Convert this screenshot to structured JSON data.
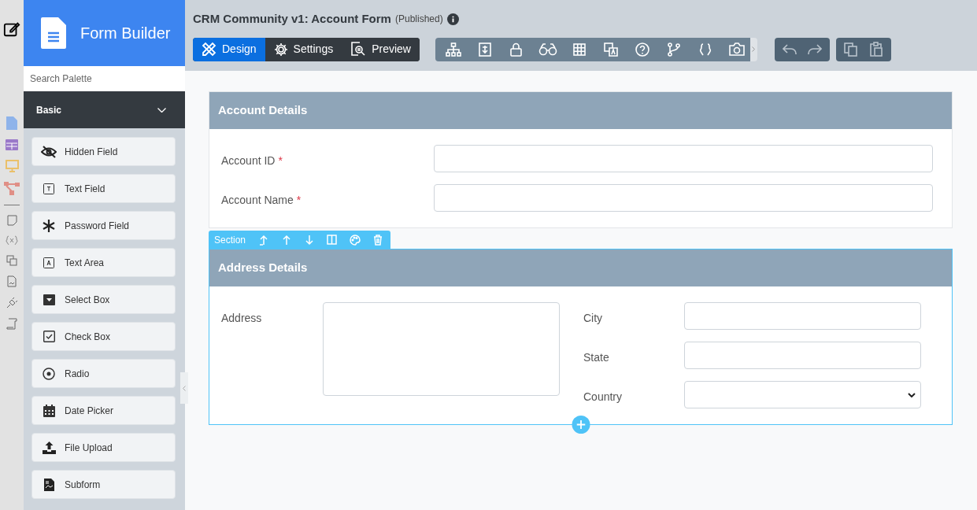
{
  "app": {
    "title": "Form Builder"
  },
  "palette_search": {
    "placeholder": "Search Palette"
  },
  "category": {
    "label": "Basic",
    "expanded": true
  },
  "palette": [
    {
      "label": "Hidden Field",
      "kind": "hidden"
    },
    {
      "label": "Text Field",
      "kind": "text"
    },
    {
      "label": "Password Field",
      "kind": "password"
    },
    {
      "label": "Text Area",
      "kind": "textarea"
    },
    {
      "label": "Select Box",
      "kind": "select"
    },
    {
      "label": "Check Box",
      "kind": "checkbox"
    },
    {
      "label": "Radio",
      "kind": "radio"
    },
    {
      "label": "Date Picker",
      "kind": "date"
    },
    {
      "label": "File Upload",
      "kind": "upload"
    },
    {
      "label": "Subform",
      "kind": "subform"
    }
  ],
  "header": {
    "title": "CRM Community v1: Account Form",
    "status": "(Published)"
  },
  "tabs": [
    {
      "label": "Design",
      "selected": true,
      "kind": "design"
    },
    {
      "label": "Settings",
      "selected": false,
      "kind": "settings"
    },
    {
      "label": "Preview",
      "selected": false,
      "kind": "preview"
    }
  ],
  "sections": [
    {
      "title": "Account Details",
      "selected": false,
      "fields": [
        {
          "label": "Account ID",
          "required_mark": "*",
          "kind": "text"
        },
        {
          "label": "Account Name",
          "required_mark": "*",
          "kind": "text"
        }
      ]
    },
    {
      "title": "Address Details",
      "selected": true,
      "toolbar_label": "Section",
      "columns": [
        {
          "fields": [
            {
              "label": "Address",
              "kind": "textarea"
            }
          ]
        },
        {
          "fields": [
            {
              "label": "City",
              "kind": "text"
            },
            {
              "label": "State",
              "kind": "text"
            },
            {
              "label": "Country",
              "kind": "select"
            }
          ]
        }
      ]
    }
  ]
}
